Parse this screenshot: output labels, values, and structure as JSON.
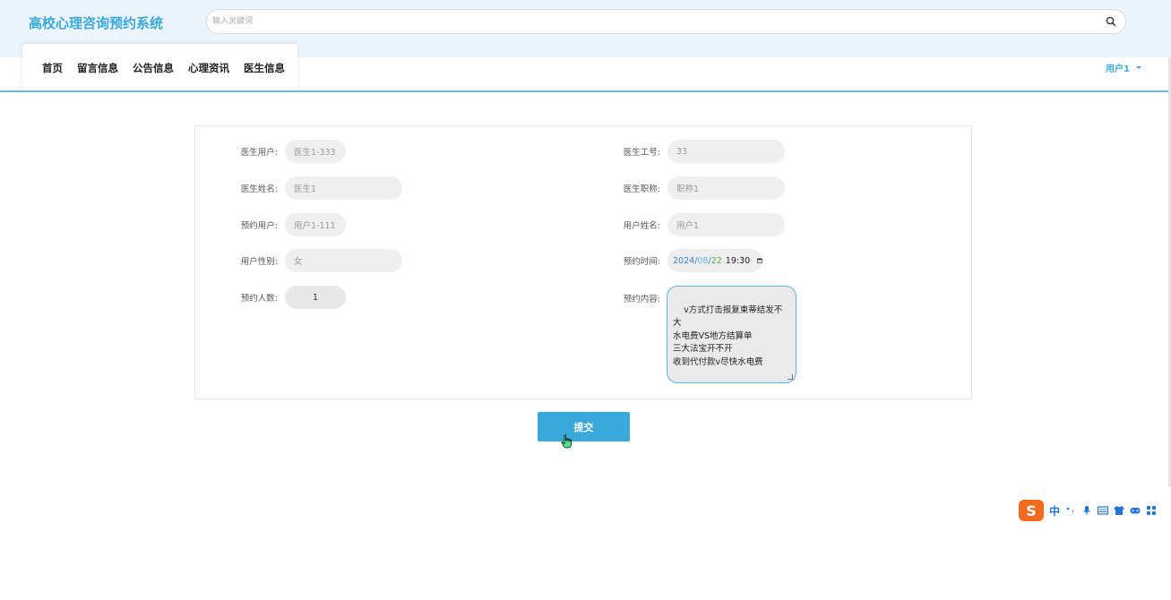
{
  "header": {
    "title": "高校心理咨询预约系统",
    "search_placeholder": "输入关键词"
  },
  "nav": {
    "items": [
      "首页",
      "留言信息",
      "公告信息",
      "心理资讯",
      "医生信息"
    ]
  },
  "user_menu": {
    "label": "用户1"
  },
  "form": {
    "doctor_user": {
      "label": "医生用户:",
      "value": "医生1-333"
    },
    "doctor_no": {
      "label": "医生工号:",
      "value": "33"
    },
    "doctor_name": {
      "label": "医生姓名:",
      "value": "医生1"
    },
    "doctor_title": {
      "label": "医生职称:",
      "value": "职称1"
    },
    "booking_user": {
      "label": "预约用户:",
      "value": "用户1-111"
    },
    "user_name": {
      "label": "用户姓名:",
      "value": "用户1"
    },
    "user_gender": {
      "label": "用户性别:",
      "value": "女"
    },
    "booking_time": {
      "label": "预约时间:",
      "year": "2024",
      "month": "08",
      "day": "22",
      "time": "19:30"
    },
    "booking_count": {
      "label": "预约人数:",
      "value": "1"
    },
    "booking_content": {
      "label": "预约内容:",
      "value": "v方式打击报复柬蒂结发不大\n水电费VS地方结算单\n三大法宝开不开\n收到代付款v尽快水电费"
    },
    "submit_label": "提交"
  },
  "ime": {
    "logo": "S",
    "lang": "中"
  },
  "colors": {
    "accent": "#3aa9da",
    "header_bg": "#edf5fc"
  }
}
